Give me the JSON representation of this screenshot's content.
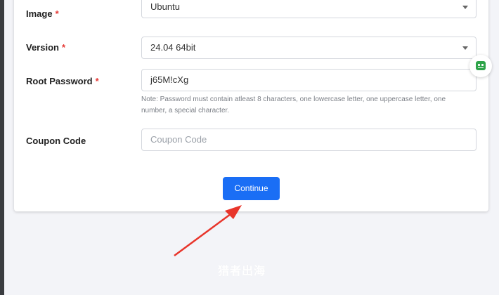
{
  "form": {
    "image": {
      "label": "Image",
      "required_mark": "*",
      "value": "Ubuntu"
    },
    "version": {
      "label": "Version",
      "required_mark": "*",
      "value": "24.04 64bit"
    },
    "root_password": {
      "label": "Root Password",
      "required_mark": "*",
      "value": "j65M!cXg",
      "note_line1": "Note: Password must contain atleast 8 characters, one lowercase letter, one uppercase letter, one",
      "note_line2": "number, a special character."
    },
    "coupon": {
      "label": "Coupon Code",
      "placeholder": "Coupon Code"
    },
    "continue_label": "Continue"
  },
  "watermark": "猎者出海",
  "colors": {
    "primary": "#1a6ef5",
    "required": "#e53935",
    "arrow": "#e8352b",
    "widget_icon": "#2fa44a"
  },
  "icons": {
    "select_caret": "chevron-down-icon",
    "side_widget": "robot-icon"
  }
}
